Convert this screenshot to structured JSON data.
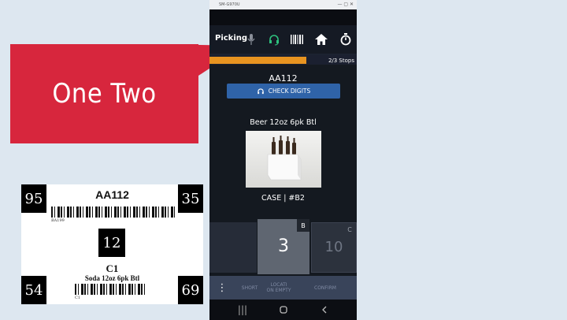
{
  "callout": {
    "text": "One Two"
  },
  "label_card": {
    "top_left_number": "95",
    "top_right_number": "35",
    "bottom_left_number": "54",
    "bottom_right_number": "69",
    "location_code": "AA112",
    "top_barcode_caption": "BA199",
    "check_digits": "12",
    "item_location": "C1",
    "item_description": "Soda 12oz 6pk Btl",
    "bottom_barcode_caption": "C1"
  },
  "phone": {
    "window_title": "SM-G970U",
    "app_title": "Picking",
    "icons": [
      "mic-icon",
      "headset-icon",
      "barcode-icon",
      "home-icon",
      "timer-icon"
    ],
    "progress": {
      "fraction": 0.66,
      "label": "2/3 Stops"
    },
    "location_code": "AA112",
    "check_digits_label": "CHECK DIGITS",
    "product_name": "Beer 12oz 6pk Btl",
    "case_info": "CASE | #B2",
    "tiles": [
      {
        "badge": "B",
        "value": "3"
      },
      {
        "badge": "C",
        "value": "10"
      }
    ],
    "actions": {
      "more": "⋮",
      "short": "SHORT",
      "location_empty": "LOCATI ON EMPTY",
      "confirm": "CONFIRM"
    },
    "colors": {
      "accent": "#e89420",
      "button": "#2f63a8",
      "callout": "#d7263d"
    }
  }
}
